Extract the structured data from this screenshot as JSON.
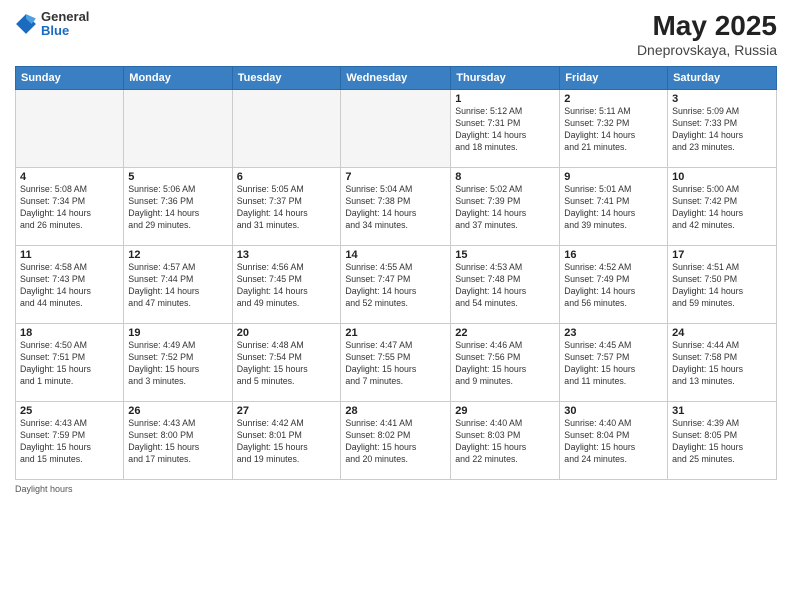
{
  "header": {
    "logo_general": "General",
    "logo_blue": "Blue",
    "month_year": "May 2025",
    "location": "Dneprovskaya, Russia"
  },
  "days_of_week": [
    "Sunday",
    "Monday",
    "Tuesday",
    "Wednesday",
    "Thursday",
    "Friday",
    "Saturday"
  ],
  "weeks": [
    [
      {
        "day": "",
        "info": ""
      },
      {
        "day": "",
        "info": ""
      },
      {
        "day": "",
        "info": ""
      },
      {
        "day": "",
        "info": ""
      },
      {
        "day": "1",
        "info": "Sunrise: 5:12 AM\nSunset: 7:31 PM\nDaylight: 14 hours\nand 18 minutes."
      },
      {
        "day": "2",
        "info": "Sunrise: 5:11 AM\nSunset: 7:32 PM\nDaylight: 14 hours\nand 21 minutes."
      },
      {
        "day": "3",
        "info": "Sunrise: 5:09 AM\nSunset: 7:33 PM\nDaylight: 14 hours\nand 23 minutes."
      }
    ],
    [
      {
        "day": "4",
        "info": "Sunrise: 5:08 AM\nSunset: 7:34 PM\nDaylight: 14 hours\nand 26 minutes."
      },
      {
        "day": "5",
        "info": "Sunrise: 5:06 AM\nSunset: 7:36 PM\nDaylight: 14 hours\nand 29 minutes."
      },
      {
        "day": "6",
        "info": "Sunrise: 5:05 AM\nSunset: 7:37 PM\nDaylight: 14 hours\nand 31 minutes."
      },
      {
        "day": "7",
        "info": "Sunrise: 5:04 AM\nSunset: 7:38 PM\nDaylight: 14 hours\nand 34 minutes."
      },
      {
        "day": "8",
        "info": "Sunrise: 5:02 AM\nSunset: 7:39 PM\nDaylight: 14 hours\nand 37 minutes."
      },
      {
        "day": "9",
        "info": "Sunrise: 5:01 AM\nSunset: 7:41 PM\nDaylight: 14 hours\nand 39 minutes."
      },
      {
        "day": "10",
        "info": "Sunrise: 5:00 AM\nSunset: 7:42 PM\nDaylight: 14 hours\nand 42 minutes."
      }
    ],
    [
      {
        "day": "11",
        "info": "Sunrise: 4:58 AM\nSunset: 7:43 PM\nDaylight: 14 hours\nand 44 minutes."
      },
      {
        "day": "12",
        "info": "Sunrise: 4:57 AM\nSunset: 7:44 PM\nDaylight: 14 hours\nand 47 minutes."
      },
      {
        "day": "13",
        "info": "Sunrise: 4:56 AM\nSunset: 7:45 PM\nDaylight: 14 hours\nand 49 minutes."
      },
      {
        "day": "14",
        "info": "Sunrise: 4:55 AM\nSunset: 7:47 PM\nDaylight: 14 hours\nand 52 minutes."
      },
      {
        "day": "15",
        "info": "Sunrise: 4:53 AM\nSunset: 7:48 PM\nDaylight: 14 hours\nand 54 minutes."
      },
      {
        "day": "16",
        "info": "Sunrise: 4:52 AM\nSunset: 7:49 PM\nDaylight: 14 hours\nand 56 minutes."
      },
      {
        "day": "17",
        "info": "Sunrise: 4:51 AM\nSunset: 7:50 PM\nDaylight: 14 hours\nand 59 minutes."
      }
    ],
    [
      {
        "day": "18",
        "info": "Sunrise: 4:50 AM\nSunset: 7:51 PM\nDaylight: 15 hours\nand 1 minute."
      },
      {
        "day": "19",
        "info": "Sunrise: 4:49 AM\nSunset: 7:52 PM\nDaylight: 15 hours\nand 3 minutes."
      },
      {
        "day": "20",
        "info": "Sunrise: 4:48 AM\nSunset: 7:54 PM\nDaylight: 15 hours\nand 5 minutes."
      },
      {
        "day": "21",
        "info": "Sunrise: 4:47 AM\nSunset: 7:55 PM\nDaylight: 15 hours\nand 7 minutes."
      },
      {
        "day": "22",
        "info": "Sunrise: 4:46 AM\nSunset: 7:56 PM\nDaylight: 15 hours\nand 9 minutes."
      },
      {
        "day": "23",
        "info": "Sunrise: 4:45 AM\nSunset: 7:57 PM\nDaylight: 15 hours\nand 11 minutes."
      },
      {
        "day": "24",
        "info": "Sunrise: 4:44 AM\nSunset: 7:58 PM\nDaylight: 15 hours\nand 13 minutes."
      }
    ],
    [
      {
        "day": "25",
        "info": "Sunrise: 4:43 AM\nSunset: 7:59 PM\nDaylight: 15 hours\nand 15 minutes."
      },
      {
        "day": "26",
        "info": "Sunrise: 4:43 AM\nSunset: 8:00 PM\nDaylight: 15 hours\nand 17 minutes."
      },
      {
        "day": "27",
        "info": "Sunrise: 4:42 AM\nSunset: 8:01 PM\nDaylight: 15 hours\nand 19 minutes."
      },
      {
        "day": "28",
        "info": "Sunrise: 4:41 AM\nSunset: 8:02 PM\nDaylight: 15 hours\nand 20 minutes."
      },
      {
        "day": "29",
        "info": "Sunrise: 4:40 AM\nSunset: 8:03 PM\nDaylight: 15 hours\nand 22 minutes."
      },
      {
        "day": "30",
        "info": "Sunrise: 4:40 AM\nSunset: 8:04 PM\nDaylight: 15 hours\nand 24 minutes."
      },
      {
        "day": "31",
        "info": "Sunrise: 4:39 AM\nSunset: 8:05 PM\nDaylight: 15 hours\nand 25 minutes."
      }
    ]
  ],
  "footer": {
    "note": "Daylight hours"
  }
}
